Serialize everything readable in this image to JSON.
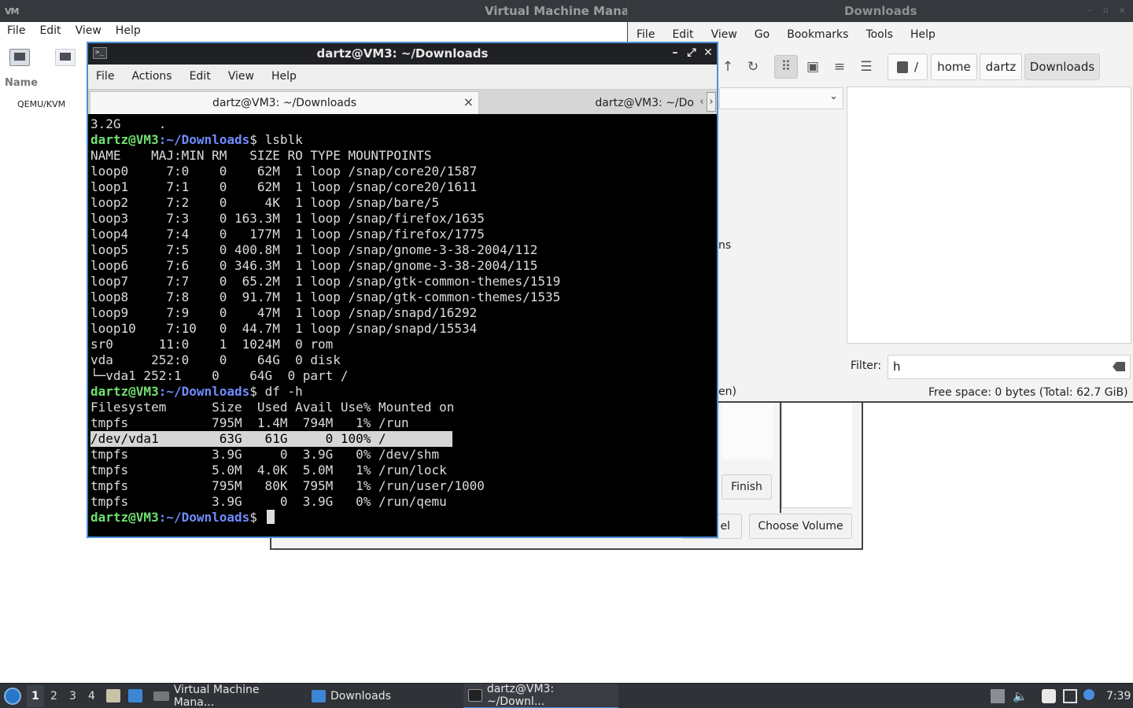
{
  "vmm": {
    "title": "Virtual Machine Mana",
    "menu": [
      "File",
      "Edit",
      "View",
      "Help"
    ],
    "column_name": "Name",
    "connection": "QEMU/KVM"
  },
  "dialog": {
    "finish": "Finish",
    "cancel": "el",
    "choose_volume": "Choose Volume"
  },
  "file_manager": {
    "title": "Downloads",
    "menu": [
      "File",
      "Edit",
      "View",
      "Go",
      "Bookmarks",
      "Tools",
      "Help"
    ],
    "breadcrumbs": [
      "/",
      "home",
      "dartz",
      "Downloads"
    ],
    "side_fragment_1": "ns",
    "side_fragment_2": "en)",
    "filter_label": "Filter:",
    "filter_value": "h",
    "free_space": "Free space: 0 bytes (Total: 62.7 GiB)"
  },
  "terminal": {
    "title": "dartz@VM3: ~/Downloads",
    "menu": [
      "File",
      "Actions",
      "Edit",
      "View",
      "Help"
    ],
    "tabs": [
      "dartz@VM3: ~/Downloads",
      "dartz@VM3: ~/Do"
    ],
    "prompt_user": "dartz@VM3",
    "prompt_path": ":~/Downloads",
    "lines": [
      {
        "text": "3.2G     ."
      },
      {
        "prompt": true,
        "cmd": "$ lsblk"
      },
      {
        "text": "NAME    MAJ:MIN RM   SIZE RO TYPE MOUNTPOINTS"
      },
      {
        "text": "loop0     7:0    0    62M  1 loop /snap/core20/1587"
      },
      {
        "text": "loop1     7:1    0    62M  1 loop /snap/core20/1611"
      },
      {
        "text": "loop2     7:2    0     4K  1 loop /snap/bare/5"
      },
      {
        "text": "loop3     7:3    0 163.3M  1 loop /snap/firefox/1635"
      },
      {
        "text": "loop4     7:4    0   177M  1 loop /snap/firefox/1775"
      },
      {
        "text": "loop5     7:5    0 400.8M  1 loop /snap/gnome-3-38-2004/112"
      },
      {
        "text": "loop6     7:6    0 346.3M  1 loop /snap/gnome-3-38-2004/115"
      },
      {
        "text": "loop7     7:7    0  65.2M  1 loop /snap/gtk-common-themes/1519"
      },
      {
        "text": "loop8     7:8    0  91.7M  1 loop /snap/gtk-common-themes/1535"
      },
      {
        "text": "loop9     7:9    0    47M  1 loop /snap/snapd/16292"
      },
      {
        "text": "loop10    7:10   0  44.7M  1 loop /snap/snapd/15534"
      },
      {
        "text": "sr0      11:0    1  1024M  0 rom"
      },
      {
        "text": "vda     252:0    0    64G  0 disk"
      },
      {
        "text": "└─vda1 252:1    0    64G  0 part /"
      },
      {
        "prompt": true,
        "cmd": "$ df -h"
      },
      {
        "text": "Filesystem      Size  Used Avail Use% Mounted on"
      },
      {
        "text": "tmpfs           795M  1.4M  794M   1% /run"
      },
      {
        "text": "/dev/vda1        63G   61G     0 100% /",
        "selected": true
      },
      {
        "text": "tmpfs           3.9G     0  3.9G   0% /dev/shm"
      },
      {
        "text": "tmpfs           5.0M  4.0K  5.0M   1% /run/lock"
      },
      {
        "text": "tmpfs           795M   80K  795M   1% /run/user/1000"
      },
      {
        "text": "tmpfs           3.9G     0  3.9G   0% /run/qemu"
      },
      {
        "prompt": true,
        "cmd": "$ ",
        "cursor": true
      }
    ]
  },
  "taskbar": {
    "workspaces": [
      "1",
      "2",
      "3",
      "4"
    ],
    "active_workspace": "1",
    "tasks": [
      {
        "label": "Virtual Machine Mana...",
        "icon": "vmm-icon"
      },
      {
        "label": "Downloads",
        "icon": "folder-icon"
      },
      {
        "label": "dartz@VM3: ~/Downl...",
        "icon": "terminal-icon"
      }
    ],
    "clock": "7:39"
  },
  "colors": {
    "titlebar": "#35383d",
    "terminal_bg": "#000000",
    "prompt_user": "#6fe06f",
    "prompt_path": "#6f8cff",
    "focus_border": "#4a90d9",
    "taskbar": "#2f3237"
  }
}
